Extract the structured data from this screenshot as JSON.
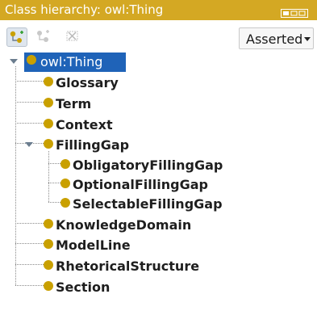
{
  "header": {
    "title": "Class hierarchy: owl:Thing"
  },
  "toolbar": {
    "view_mode": "Asserted"
  },
  "tree": {
    "root": "owl:Thing",
    "children": {
      "glossary": "Glossary",
      "term": "Term",
      "context": "Context",
      "filling_gap": "FillingGap",
      "obligatory": "ObligatoryFillingGap",
      "optional": "OptionalFillingGap",
      "selectable": "SelectableFillingGap",
      "knowledge_domain": "KnowledgeDomain",
      "model_line": "ModelLine",
      "rhetorical_structure": "RhetoricalStructure",
      "section": "Section"
    }
  },
  "colors": {
    "title_bar": "#d4a823",
    "selection": "#1f63b8",
    "class_dot": "#c9a000"
  },
  "icons": {
    "view_control": "view-toggle-icon",
    "add_subclass": "add-subclass-icon",
    "add_sibling": "add-sibling-icon",
    "delete": "delete-class-icon"
  }
}
